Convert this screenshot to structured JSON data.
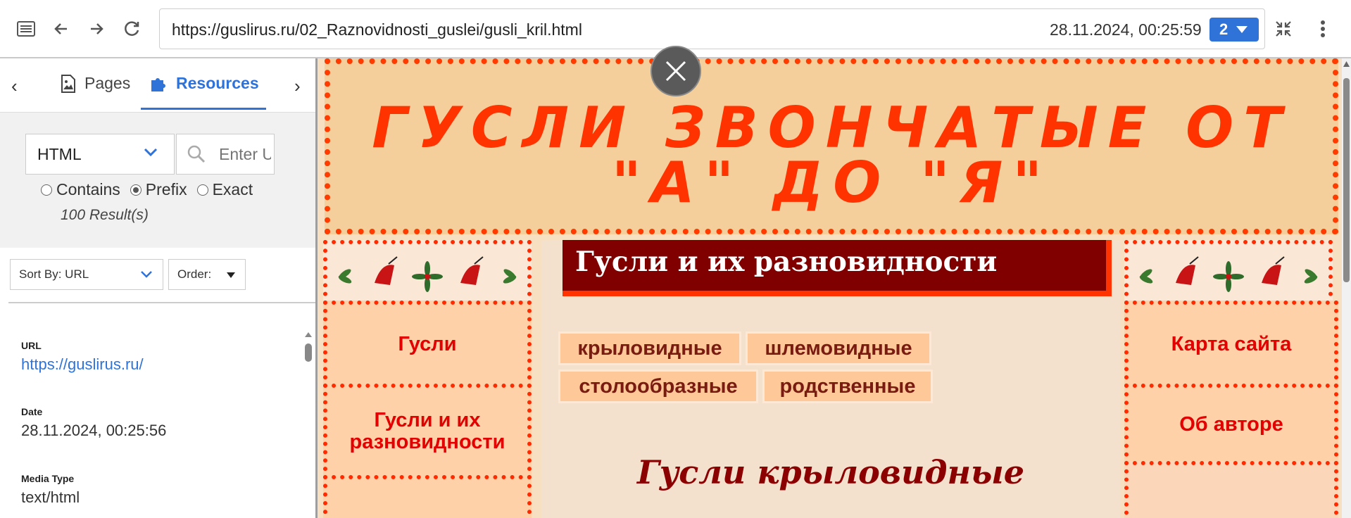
{
  "toolbar": {
    "url": "https://guslirus.ru/02_Raznovidnosti_guslei/gusli_kril.html",
    "datetime": "28.11.2024, 00:25:59",
    "capture_count": "2",
    "accent_color": "#2f73d8",
    "icons": [
      "sidebar-toggle-icon",
      "back-arrow-icon",
      "forward-arrow-icon",
      "reload-icon",
      "collapse-icon",
      "more-vert-icon"
    ]
  },
  "sidebar": {
    "tabs": [
      {
        "label": "Pages",
        "icon": "document-image-icon"
      },
      {
        "label": "Resources",
        "icon": "puzzle-icon",
        "active": true
      }
    ],
    "filter": {
      "type_selected": "HTML",
      "search_placeholder": "Enter URL",
      "match_options": [
        "Contains",
        "Prefix",
        "Exact"
      ],
      "match_selected": "Prefix",
      "results": "100 Result(s)"
    },
    "sort": {
      "sort_by": "Sort By: URL",
      "order": "Order:"
    },
    "detail": {
      "url_label": "URL",
      "url_value": "https://guslirus.ru/",
      "date_label": "Date",
      "date_value": "28.11.2024, 00:25:56",
      "media_label": "Media Type",
      "media_value": "text/html"
    }
  },
  "webpage": {
    "header_title_line1": "ГУСЛИ ЗВОНЧАТЫЕ ОТ",
    "header_title_line2": "\"А\" ДО \"Я\"",
    "left_nav": [
      "Гусли",
      "Гусли и их разновидности"
    ],
    "right_nav": [
      "Карта сайта",
      "Об авторе"
    ],
    "section_title": "Гусли и их разновидности",
    "chips": [
      "крыловидные",
      "шлемовидные",
      "столообразные",
      "родственные"
    ],
    "subtitle": "Гусли крыловидные",
    "colors": {
      "red": "#ff3300",
      "maroon": "#800000",
      "peach": "#ffd1a8"
    }
  }
}
